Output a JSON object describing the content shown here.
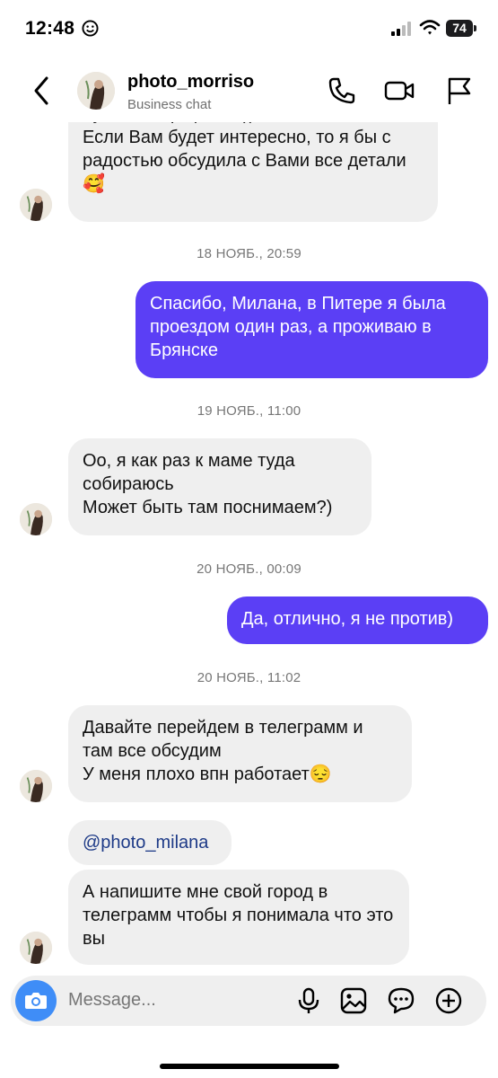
{
  "status_bar": {
    "time": "12:48",
    "battery": "74"
  },
  "header": {
    "name": "photo_morriso",
    "subtitle": "Business chat"
  },
  "messages": {
    "m1": "лучшее портфолио))\nЕсли Вам будет интересно, то я бы с радостью обсудила с Вами все детали 🥰",
    "t1": "18 НОЯБ., 20:59",
    "m2": "Спасибо, Милана, в Питере я была проездом один раз, а проживаю в Брянске",
    "t2": "19 НОЯБ., 11:00",
    "m3": "Оо, я как раз к маме туда собираюсь\nМожет быть там поснимаем?)",
    "t3": "20 НОЯБ., 00:09",
    "m4": "Да, отлично, я не против)",
    "t4": "20 НОЯБ., 11:02",
    "m5": "Давайте перейдем в телеграмм и там все обсудим\nУ меня плохо впн работает😔",
    "m6": "@photo_milana",
    "m7": "А напишите мне свой город в телеграмм чтобы я понимала что это вы"
  },
  "composer": {
    "placeholder": "Message..."
  },
  "colors": {
    "outgoing_bubble": "#5b3ff5",
    "incoming_bubble": "#efefef",
    "camera_button": "#3f8df7",
    "mention_link": "#1d3a87"
  },
  "icons": [
    "back-chevron-icon",
    "phone-icon",
    "video-icon",
    "flag-icon",
    "camera-icon",
    "microphone-icon",
    "gallery-icon",
    "sticker-icon",
    "plus-icon"
  ]
}
